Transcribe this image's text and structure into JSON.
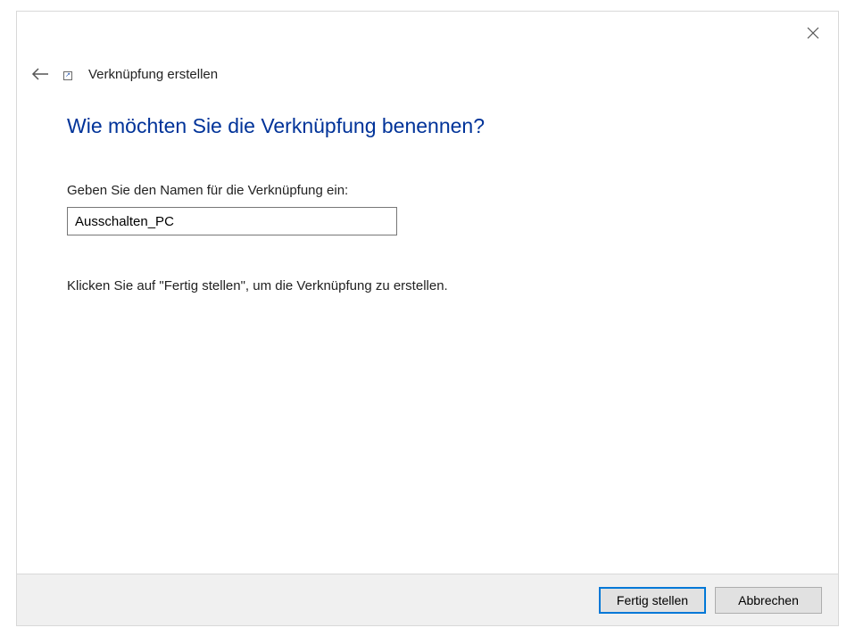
{
  "header": {
    "wizard_title": "Verknüpfung erstellen"
  },
  "main": {
    "heading": "Wie möchten Sie die Verknüpfung benennen?",
    "field_label": "Geben Sie den Namen für die Verknüpfung ein:",
    "shortcut_name_value": "Ausschalten_PC",
    "instruction": "Klicken Sie auf \"Fertig stellen\", um die Verknüpfung zu erstellen."
  },
  "buttons": {
    "finish": "Fertig stellen",
    "cancel": "Abbrechen"
  }
}
